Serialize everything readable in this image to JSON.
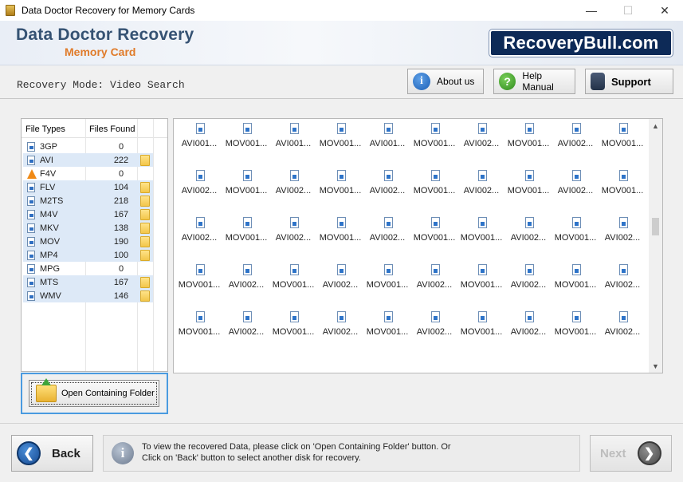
{
  "window": {
    "title": "Data Doctor Recovery for Memory Cards",
    "controls": {
      "minimize": "—",
      "maximize": "☐",
      "close": "✕"
    }
  },
  "header": {
    "title": "Data Doctor Recovery",
    "subtitle": "Memory Card",
    "logo": "RecoveryBull.com"
  },
  "modebar": {
    "mode_text": "Recovery Mode: Video Search",
    "about_label": "About us",
    "help_label": "Help Manual",
    "support_label": "Support"
  },
  "file_types": {
    "col_type": "File Types",
    "col_found": "Files Found",
    "rows": [
      {
        "name": "3GP",
        "count": "0",
        "highlight": false,
        "folder": false,
        "icon": "video-file-icon"
      },
      {
        "name": "AVI",
        "count": "222",
        "highlight": true,
        "folder": true,
        "icon": "video-file-icon"
      },
      {
        "name": "F4V",
        "count": "0",
        "highlight": false,
        "folder": false,
        "icon": "vlc-cone-icon"
      },
      {
        "name": "FLV",
        "count": "104",
        "highlight": true,
        "folder": true,
        "icon": "video-file-icon"
      },
      {
        "name": "M2TS",
        "count": "218",
        "highlight": true,
        "folder": true,
        "icon": "video-file-icon"
      },
      {
        "name": "M4V",
        "count": "167",
        "highlight": true,
        "folder": true,
        "icon": "video-file-icon"
      },
      {
        "name": "MKV",
        "count": "138",
        "highlight": true,
        "folder": true,
        "icon": "video-file-icon"
      },
      {
        "name": "MOV",
        "count": "190",
        "highlight": true,
        "folder": true,
        "icon": "video-file-icon"
      },
      {
        "name": "MP4",
        "count": "100",
        "highlight": true,
        "folder": true,
        "icon": "video-file-icon"
      },
      {
        "name": "MPG",
        "count": "0",
        "highlight": false,
        "folder": false,
        "icon": "video-file-icon"
      },
      {
        "name": "MTS",
        "count": "167",
        "highlight": true,
        "folder": true,
        "icon": "video-file-icon"
      },
      {
        "name": "WMV",
        "count": "146",
        "highlight": true,
        "folder": true,
        "icon": "video-file-icon"
      }
    ]
  },
  "open_folder_label": "Open Containing Folder",
  "files_grid": [
    [
      "AVI001...",
      "MOV001...",
      "AVI001...",
      "MOV001...",
      "AVI001...",
      "MOV001...",
      "AVI002...",
      "MOV001...",
      "AVI002...",
      "MOV001..."
    ],
    [
      "AVI002...",
      "MOV001...",
      "AVI002...",
      "MOV001...",
      "AVI002...",
      "MOV001...",
      "AVI002...",
      "MOV001...",
      "AVI002...",
      "MOV001..."
    ],
    [
      "AVI002...",
      "MOV001...",
      "AVI002...",
      "MOV001...",
      "AVI002...",
      "MOV001...",
      "MOV001...",
      "AVI002...",
      "MOV001...",
      "AVI002..."
    ],
    [
      "MOV001...",
      "AVI002...",
      "MOV001...",
      "AVI002...",
      "MOV001...",
      "AVI002...",
      "MOV001...",
      "AVI002...",
      "MOV001...",
      "AVI002..."
    ],
    [
      "MOV001...",
      "AVI002...",
      "MOV001...",
      "AVI002...",
      "MOV001...",
      "AVI002...",
      "MOV001...",
      "AVI002...",
      "MOV001...",
      "AVI002..."
    ]
  ],
  "bottom": {
    "back_label": "Back",
    "message_line1": "To view the recovered Data, please click on 'Open Containing Folder' button. Or",
    "message_line2": "Click on 'Back' button to select another disk for recovery.",
    "next_label": "Next"
  },
  "colors": {
    "brand_title": "#355273",
    "brand_sub": "#e07b2a",
    "logo_bg": "#0d2a57",
    "row_highlight": "#dde9f7",
    "focus_border": "#4a9be0"
  }
}
